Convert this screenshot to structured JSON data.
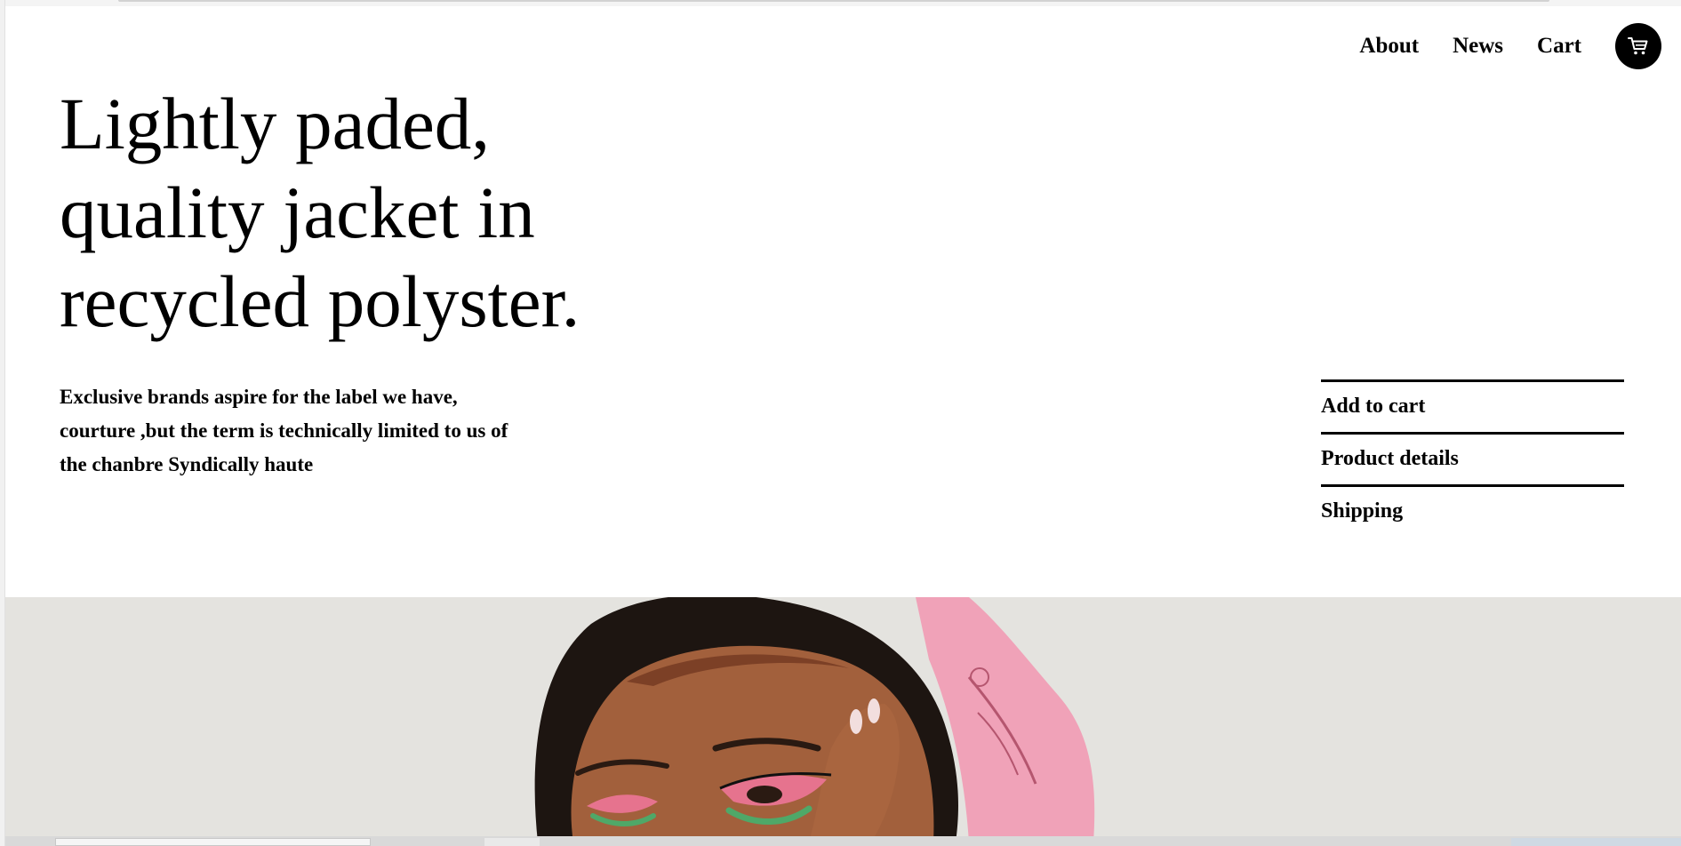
{
  "nav": {
    "links": [
      {
        "label": "About"
      },
      {
        "label": "News"
      },
      {
        "label": "Cart"
      }
    ],
    "cart_icon": "shopping-cart-icon"
  },
  "hero": {
    "title": "Lightly paded, quality jacket in recycled polyster.",
    "description": "Exclusive brands aspire for the label we have, courture ,but the term is technically limited to us of the chanbre Syndically haute"
  },
  "actions": [
    {
      "label": "Add to cart"
    },
    {
      "label": "Product details"
    },
    {
      "label": "Shipping"
    }
  ],
  "banner": {
    "image": "model-portrait-with-pink-headscarf",
    "colors": {
      "background": "#e4e3df",
      "scarf": "#f0a2b8",
      "skin": "#9a5c3c",
      "hair": "#1d1511"
    }
  },
  "colors": {
    "page_background": "#ffffff",
    "text": "#000000",
    "accent": "#000000"
  }
}
